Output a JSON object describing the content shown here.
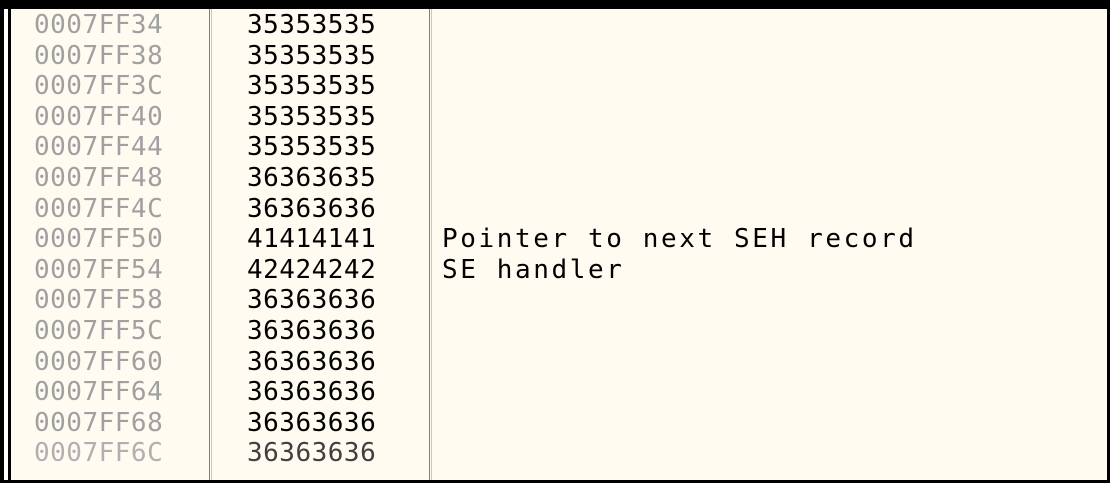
{
  "stack": {
    "rows": [
      {
        "address": "0007FF34",
        "value": "35353535",
        "comment": ""
      },
      {
        "address": "0007FF38",
        "value": "35353535",
        "comment": ""
      },
      {
        "address": "0007FF3C",
        "value": "35353535",
        "comment": ""
      },
      {
        "address": "0007FF40",
        "value": "35353535",
        "comment": ""
      },
      {
        "address": "0007FF44",
        "value": "35353535",
        "comment": ""
      },
      {
        "address": "0007FF48",
        "value": "36363635",
        "comment": ""
      },
      {
        "address": "0007FF4C",
        "value": "36363636",
        "comment": ""
      },
      {
        "address": "0007FF50",
        "value": "41414141",
        "comment": "Pointer to next SEH record"
      },
      {
        "address": "0007FF54",
        "value": "42424242",
        "comment": "SE handler"
      },
      {
        "address": "0007FF58",
        "value": "36363636",
        "comment": ""
      },
      {
        "address": "0007FF5C",
        "value": "36363636",
        "comment": ""
      },
      {
        "address": "0007FF60",
        "value": "36363636",
        "comment": ""
      },
      {
        "address": "0007FF64",
        "value": "36363636",
        "comment": ""
      },
      {
        "address": "0007FF68",
        "value": "36363636",
        "comment": ""
      },
      {
        "address": "0007FF6C",
        "value": "36363636",
        "comment": ""
      }
    ]
  },
  "colors": {
    "pane_background": "#fffbf0",
    "address_text": "#a0a0a0",
    "value_text": "#000000",
    "comment_text": "#000000"
  }
}
